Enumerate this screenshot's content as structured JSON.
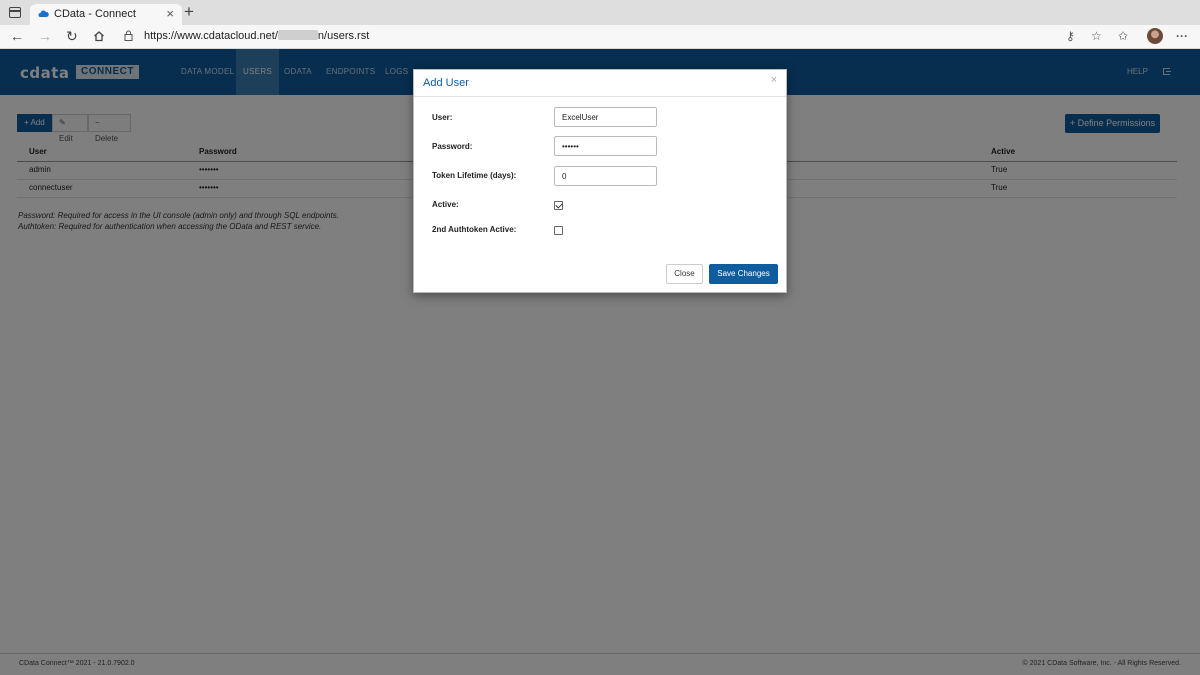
{
  "browser": {
    "tab_title": "CData - Connect",
    "tab_close": "×",
    "new_tab": "+",
    "url_prefix": "https://www.cdatacloud.net/",
    "url_suffix": "n/users.rst",
    "icons": [
      "window-icon",
      "back-icon",
      "forward-icon",
      "refresh-icon",
      "home-icon",
      "lock-icon",
      "key-icon",
      "favorites-add-icon",
      "collections-icon",
      "profile-avatar",
      "more-icon"
    ]
  },
  "header": {
    "logo_text": "cdata",
    "logo_badge": "CONNECT",
    "nav": [
      "DATA MODEL",
      "USERS",
      "ODATA",
      "ENDPOINTS",
      "LOGS"
    ],
    "active_nav": "USERS",
    "help": "HELP",
    "accent_color": "#0f5d9e"
  },
  "toolbar": {
    "add": "+ Add",
    "edit": "Edit",
    "delete": "Delete",
    "define_permissions": "+ Define Permissions"
  },
  "table": {
    "headers": {
      "user": "User",
      "password": "Password",
      "active": "Active"
    },
    "rows": [
      {
        "user": "admin",
        "password": "•••••••",
        "active": "True"
      },
      {
        "user": "connectuser",
        "password": "•••••••",
        "active": "True"
      }
    ]
  },
  "notes": {
    "password": "Password: Required for access in the UI console (admin only) and through SQL endpoints.",
    "authtoken": "Authtoken: Required for authentication when accessing the OData and REST service."
  },
  "footer": {
    "left": "CData Connect™ 2021 - 21.0.7902.0",
    "right": "© 2021 CData Software, Inc. - All Rights Reserved."
  },
  "modal": {
    "title": "Add User",
    "close_glyph": "×",
    "fields": {
      "user_label": "User:",
      "user_value": "ExcelUser",
      "password_label": "Password:",
      "password_value": "••••••",
      "token_label": "Token Lifetime (days):",
      "token_value": "0",
      "active_label": "Active:",
      "active_checked": true,
      "authtoken2_label": "2nd Authtoken Active:",
      "authtoken2_checked": false
    },
    "close_button": "Close",
    "save_button": "Save Changes"
  }
}
